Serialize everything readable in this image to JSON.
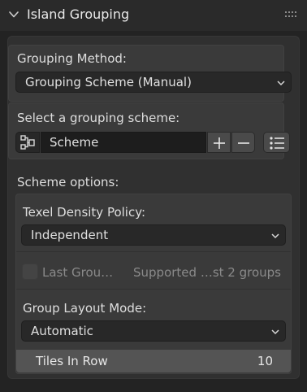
{
  "panel": {
    "title": "Island Grouping",
    "collapse_icon": "chevron-down-icon",
    "drag_icon": "grip-dots-icon"
  },
  "grouping_method": {
    "label": "Grouping Method:",
    "value": "Grouping Scheme (Manual)"
  },
  "scheme_select": {
    "label": "Select a grouping scheme:",
    "icon": "scheme-tree-icon",
    "value": "Scheme",
    "add_icon": "plus-icon",
    "remove_icon": "minus-icon",
    "list_icon": "list-icon"
  },
  "scheme_options": {
    "label": "Scheme options:",
    "texel_density_label": "Texel Density Policy:",
    "texel_density_value": "Independent",
    "last_group_label": "Last Grou…",
    "last_group_checked": false,
    "last_group_note": "Supported …st 2 groups",
    "group_layout_label": "Group Layout Mode:",
    "group_layout_value": "Automatic",
    "tiles_in_row_label": "Tiles In Row",
    "tiles_in_row_value": "10"
  },
  "colors": {
    "background": "#232323",
    "panel": "#303030",
    "field": "#282828",
    "slider": "#545454"
  }
}
